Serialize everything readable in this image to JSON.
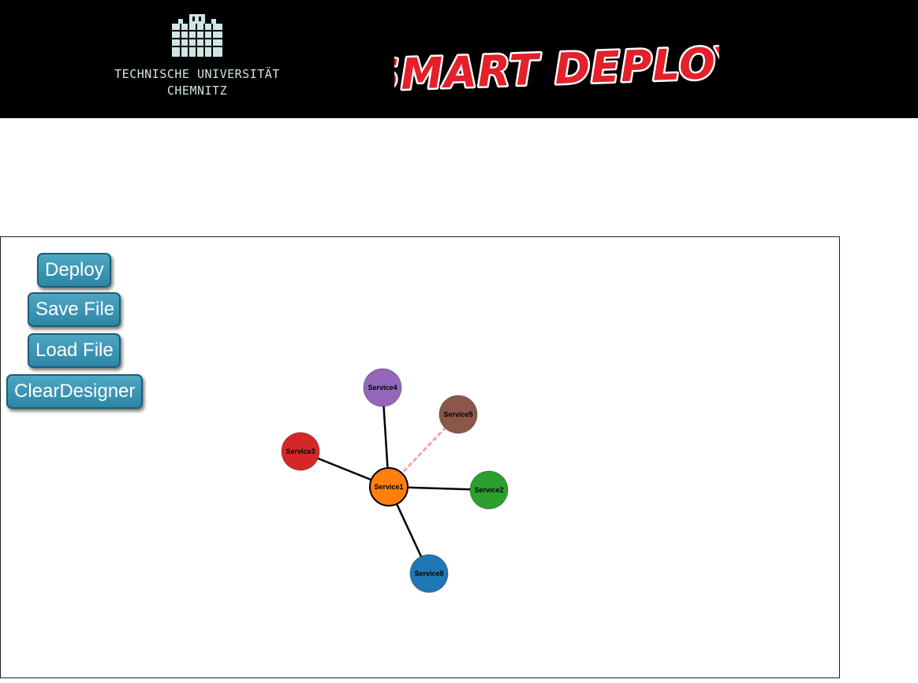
{
  "header": {
    "university_line1": "TECHNISCHE UNIVERSITÄT",
    "university_line2": "CHEMNITZ",
    "brand_title": "SMART DEPLOY"
  },
  "toolbar": {
    "deploy_label": "Deploy",
    "save_label": "Save File",
    "load_label": "Load File",
    "clear_label": "ClearDesigner"
  },
  "graph": {
    "nodes": [
      {
        "id": "Service0",
        "label": "Service0",
        "color": "#1f77b4"
      },
      {
        "id": "Service1",
        "label": "Service1",
        "color": "#ff7f0e"
      },
      {
        "id": "Service2",
        "label": "Service2",
        "color": "#2ca02c"
      },
      {
        "id": "Service3",
        "label": "Service3",
        "color": "#d62728"
      },
      {
        "id": "Service4",
        "label": "Service4",
        "color": "#9467bd"
      },
      {
        "id": "Service5",
        "label": "Service5",
        "color": "#8c564b"
      }
    ],
    "links": [
      {
        "source": "Service1",
        "target": "Service0",
        "style": "solid"
      },
      {
        "source": "Service1",
        "target": "Service2",
        "style": "solid"
      },
      {
        "source": "Service1",
        "target": "Service3",
        "style": "solid"
      },
      {
        "source": "Service1",
        "target": "Service4",
        "style": "solid"
      },
      {
        "source": "Service1",
        "target": "Service5",
        "style": "dashed"
      }
    ],
    "selected_node": "Service1",
    "link_color": "#000000",
    "pending_link_color": "#f4a3a3"
  }
}
